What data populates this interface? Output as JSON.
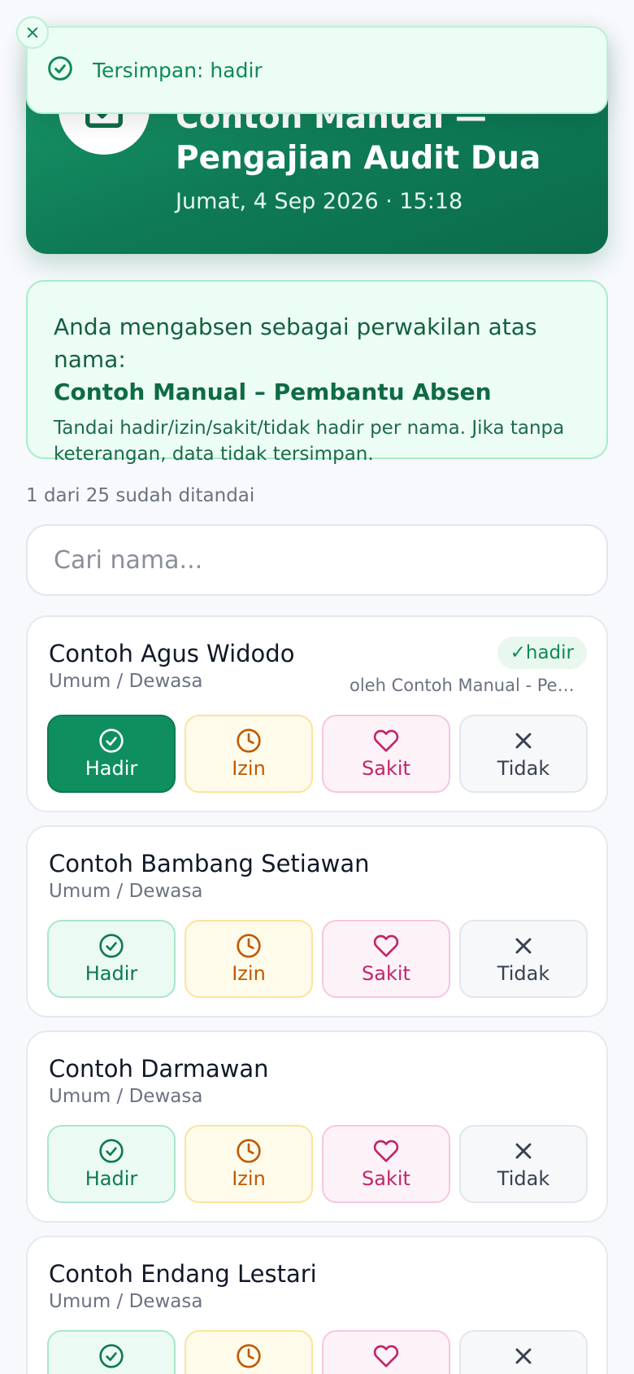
{
  "toast": {
    "message": "Tersimpan: hadir",
    "icon": "check-circle-icon"
  },
  "event": {
    "title_line1": "Contoh Manual —",
    "title_line2": "Pengajian Audit Dua",
    "date": "Jumat, 4 Sep 2026 · 15:18",
    "icon": "calendar-check-icon"
  },
  "notice": {
    "line1": "Anda mengabsen sebagai perwakilan atas nama:",
    "name": "Contoh Manual – Pembantu Absen",
    "description": "Tandai hadir/izin/sakit/tidak hadir per nama. Jika tanpa keterangan, data tidak tersimpan."
  },
  "progress": "1 dari 25 sudah ditandai",
  "search": {
    "placeholder": "Cari nama...",
    "value": ""
  },
  "buttons": {
    "hadir": "Hadir",
    "izin": "Izin",
    "sakit": "Sakit",
    "tidak": "Tidak"
  },
  "members": [
    {
      "name": "Contoh Agus Widodo",
      "group": "Umum / Dewasa",
      "status": "✓hadir",
      "marked_by": "oleh Contoh Manual - Pembantu Absen"
    },
    {
      "name": "Contoh Bambang Setiawan",
      "group": "Umum / Dewasa"
    },
    {
      "name": "Contoh Darmawan",
      "group": "Umum / Dewasa"
    },
    {
      "name": "Contoh Endang Lestari",
      "group": "Umum / Dewasa"
    }
  ],
  "colors": {
    "primary": "#0f8f5f",
    "izin": "#c05a00",
    "sakit": "#c0266a",
    "tidak": "#374151"
  }
}
